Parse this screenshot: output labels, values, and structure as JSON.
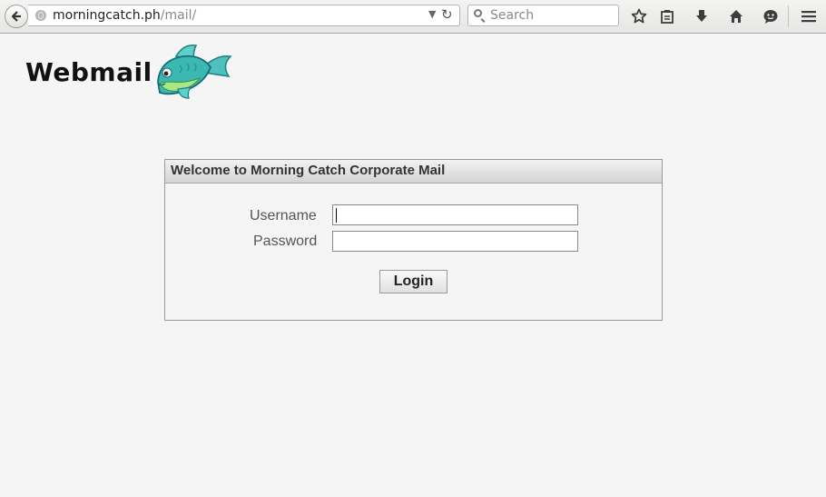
{
  "browser": {
    "url_host": "morningcatch.ph",
    "url_path": "/mail/",
    "search_placeholder": "Search",
    "icons": [
      "back-arrow-icon",
      "globe-icon",
      "dropdown-arrow-icon",
      "reload-icon",
      "search-icon",
      "bookmark-star-icon",
      "reading-list-icon",
      "download-icon",
      "home-icon",
      "chat-icon",
      "menu-icon"
    ]
  },
  "page": {
    "logo_text": "Webmail",
    "logo_icon": "fish-icon"
  },
  "login": {
    "title": "Welcome to Morning Catch Corporate Mail",
    "username_label": "Username",
    "password_label": "Password",
    "username_value": "",
    "password_value": "",
    "login_button": "Login"
  }
}
